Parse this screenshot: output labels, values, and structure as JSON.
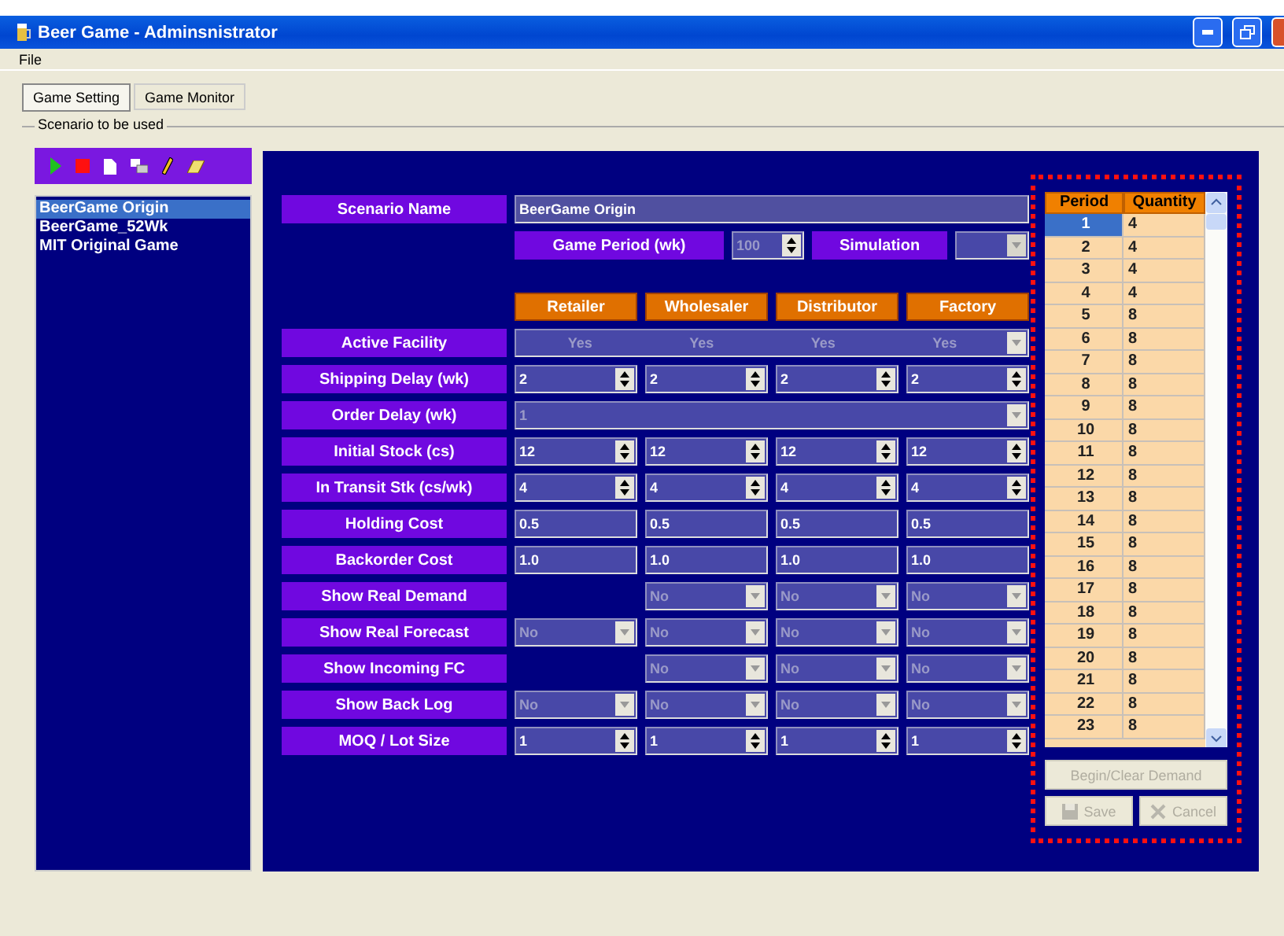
{
  "window": {
    "title": "Beer Game - Adminsnistrator"
  },
  "menu": [
    "File"
  ],
  "tabs": [
    {
      "label": "Game Setting",
      "selected": true
    },
    {
      "label": "Game Monitor",
      "selected": false
    }
  ],
  "group_title": "Scenario to be used",
  "scenarios": [
    {
      "label": "BeerGame Origin",
      "selected": true
    },
    {
      "label": "BeerGame_52Wk",
      "selected": false
    },
    {
      "label": "MIT Original Game",
      "selected": false
    }
  ],
  "scenario_name": {
    "label": "Scenario Name",
    "value": "BeerGame Origin"
  },
  "game_period": {
    "label": "Game Period (wk)",
    "value": "100",
    "disabled": true
  },
  "simulation": {
    "label": "Simulation",
    "disabled": true
  },
  "facilities": [
    "Retailer",
    "Wholesaler",
    "Distributor",
    "Factory"
  ],
  "rows": [
    {
      "label": "Active Facility",
      "kind": "span_combo",
      "values": [
        "Yes",
        "Yes",
        "Yes",
        "Yes"
      ],
      "disabled": true
    },
    {
      "label": "Shipping Delay (wk)",
      "kind": "spin",
      "cells": [
        "2",
        "2",
        "2",
        "2"
      ]
    },
    {
      "label": "Order Delay (wk)",
      "kind": "wide_combo",
      "value": "1",
      "disabled": true
    },
    {
      "label": "Initial Stock (cs)",
      "kind": "spin",
      "cells": [
        "12",
        "12",
        "12",
        "12"
      ]
    },
    {
      "label": "In Transit Stk (cs/wk)",
      "kind": "spin",
      "cells": [
        "4",
        "4",
        "4",
        "4"
      ]
    },
    {
      "label": "Holding Cost",
      "kind": "text",
      "cells": [
        "0.5",
        "0.5",
        "0.5",
        "0.5"
      ]
    },
    {
      "label": "Backorder Cost",
      "kind": "text",
      "cells": [
        "1.0",
        "1.0",
        "1.0",
        "1.0"
      ]
    },
    {
      "label": "Show Real Demand",
      "kind": "combo",
      "disabled": true,
      "cells": [
        {
          "kind": "blank"
        },
        {
          "kind": "combo",
          "value": "No"
        },
        {
          "kind": "combo",
          "value": "No"
        },
        {
          "kind": "combo",
          "value": "No"
        }
      ]
    },
    {
      "label": "Show Real Forecast",
      "kind": "combo",
      "disabled": true,
      "cells": [
        {
          "kind": "combo",
          "value": "No"
        },
        {
          "kind": "combo",
          "value": "No"
        },
        {
          "kind": "combo",
          "value": "No"
        },
        {
          "kind": "combo",
          "value": "No"
        }
      ]
    },
    {
      "label": "Show Incoming FC",
      "kind": "combo",
      "disabled": true,
      "cells": [
        {
          "kind": "blank"
        },
        {
          "kind": "combo",
          "value": "No"
        },
        {
          "kind": "combo",
          "value": "No"
        },
        {
          "kind": "combo",
          "value": "No"
        }
      ]
    },
    {
      "label": "Show Back Log",
      "kind": "combo",
      "disabled": true,
      "cells": [
        {
          "kind": "combo",
          "value": "No"
        },
        {
          "kind": "combo",
          "value": "No"
        },
        {
          "kind": "combo",
          "value": "No"
        },
        {
          "kind": "combo",
          "value": "No"
        }
      ]
    },
    {
      "label": "MOQ / Lot Size",
      "kind": "spin",
      "cells": [
        "1",
        "1",
        "1",
        "1"
      ]
    }
  ],
  "demand_table": {
    "columns": [
      "Period",
      "Quantity"
    ],
    "rows": [
      {
        "period": "1",
        "quantity": "4",
        "selected": true
      },
      {
        "period": "2",
        "quantity": "4",
        "selected": false
      },
      {
        "period": "3",
        "quantity": "4",
        "selected": false
      },
      {
        "period": "4",
        "quantity": "4",
        "selected": false
      },
      {
        "period": "5",
        "quantity": "8",
        "selected": false
      },
      {
        "period": "6",
        "quantity": "8",
        "selected": false
      },
      {
        "period": "7",
        "quantity": "8",
        "selected": false
      },
      {
        "period": "8",
        "quantity": "8",
        "selected": false
      },
      {
        "period": "9",
        "quantity": "8",
        "selected": false
      },
      {
        "period": "10",
        "quantity": "8",
        "selected": false
      },
      {
        "period": "11",
        "quantity": "8",
        "selected": false
      },
      {
        "period": "12",
        "quantity": "8",
        "selected": false
      },
      {
        "period": "13",
        "quantity": "8",
        "selected": false
      },
      {
        "period": "14",
        "quantity": "8",
        "selected": false
      },
      {
        "period": "15",
        "quantity": "8",
        "selected": false
      },
      {
        "period": "16",
        "quantity": "8",
        "selected": false
      },
      {
        "period": "17",
        "quantity": "8",
        "selected": false
      },
      {
        "period": "18",
        "quantity": "8",
        "selected": false
      },
      {
        "period": "19",
        "quantity": "8",
        "selected": false
      },
      {
        "period": "20",
        "quantity": "8",
        "selected": false
      },
      {
        "period": "21",
        "quantity": "8",
        "selected": false
      },
      {
        "period": "22",
        "quantity": "8",
        "selected": false
      },
      {
        "period": "23",
        "quantity": "8",
        "selected": false
      }
    ]
  },
  "buttons": [
    {
      "label": "Begin/Clear Demand",
      "kind": "wide",
      "disabled": true
    },
    {
      "label": "Save",
      "kind": "save",
      "disabled": true
    },
    {
      "label": "Cancel",
      "kind": "cancel",
      "disabled": true
    }
  ]
}
